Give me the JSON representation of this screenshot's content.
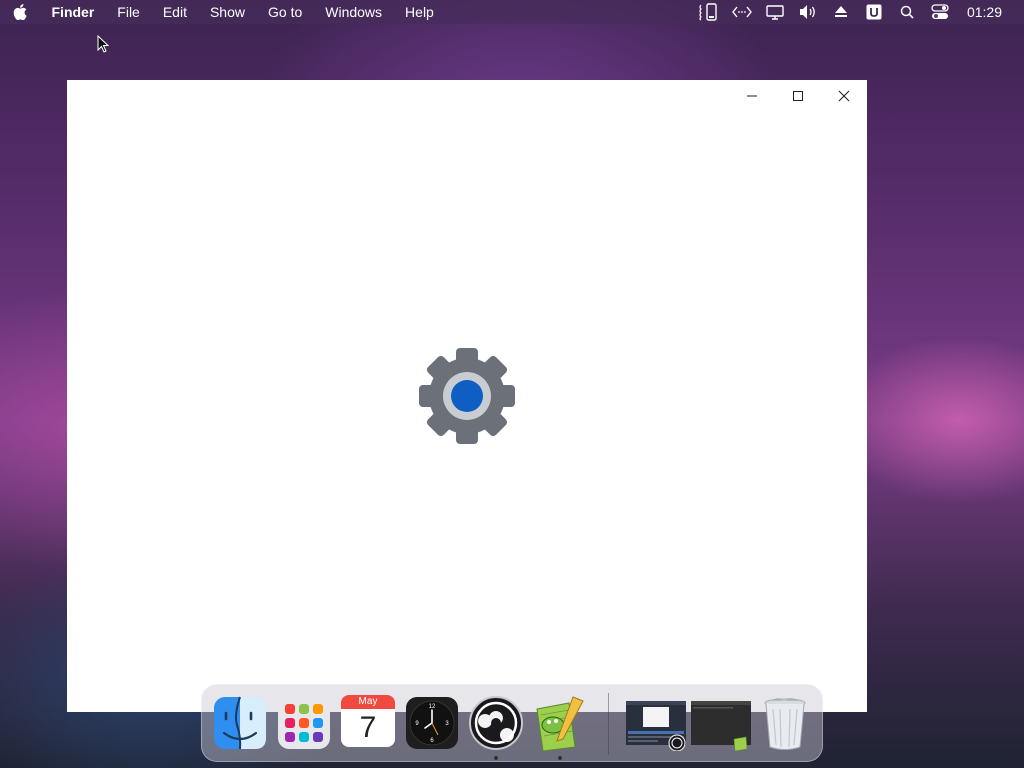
{
  "menubar": {
    "apple_icon": "apple-logo-icon",
    "app_name": "Finder",
    "items": [
      "File",
      "Edit",
      "Show",
      "Go to",
      "Windows",
      "Help"
    ],
    "status_icons": [
      "phone-mirror-icon",
      "code-arrows-icon",
      "display-icon",
      "volume-icon",
      "eject-icon",
      "u-badge-icon",
      "search-icon",
      "control-center-icon"
    ],
    "clock": "01:29"
  },
  "window": {
    "controls": [
      "minimize-icon",
      "maximize-icon",
      "close-icon"
    ],
    "content_icon": "settings-gear-icon",
    "gear_colors": {
      "body": "#6b7079",
      "ring": "#c9ccd1",
      "center": "#0f5ec4"
    }
  },
  "dock": {
    "apps": [
      {
        "name": "finder",
        "icon": "finder-icon",
        "running": false
      },
      {
        "name": "launchpad",
        "icon": "launchpad-icon",
        "running": false
      },
      {
        "name": "calendar",
        "icon": "calendar-icon",
        "running": false,
        "month": "May",
        "day": "7"
      },
      {
        "name": "clock",
        "icon": "clock-icon",
        "running": false
      },
      {
        "name": "obs-studio",
        "icon": "obs-icon",
        "running": true
      },
      {
        "name": "notepad-plus-plus",
        "icon": "notepad-icon",
        "running": true
      }
    ],
    "minimized": [
      {
        "name": "obs-window-thumbnail",
        "icon": "window-thumbnail-icon"
      },
      {
        "name": "dark-window-thumbnail",
        "icon": "window-thumbnail-icon"
      }
    ],
    "trash_icon": "trash-icon"
  }
}
